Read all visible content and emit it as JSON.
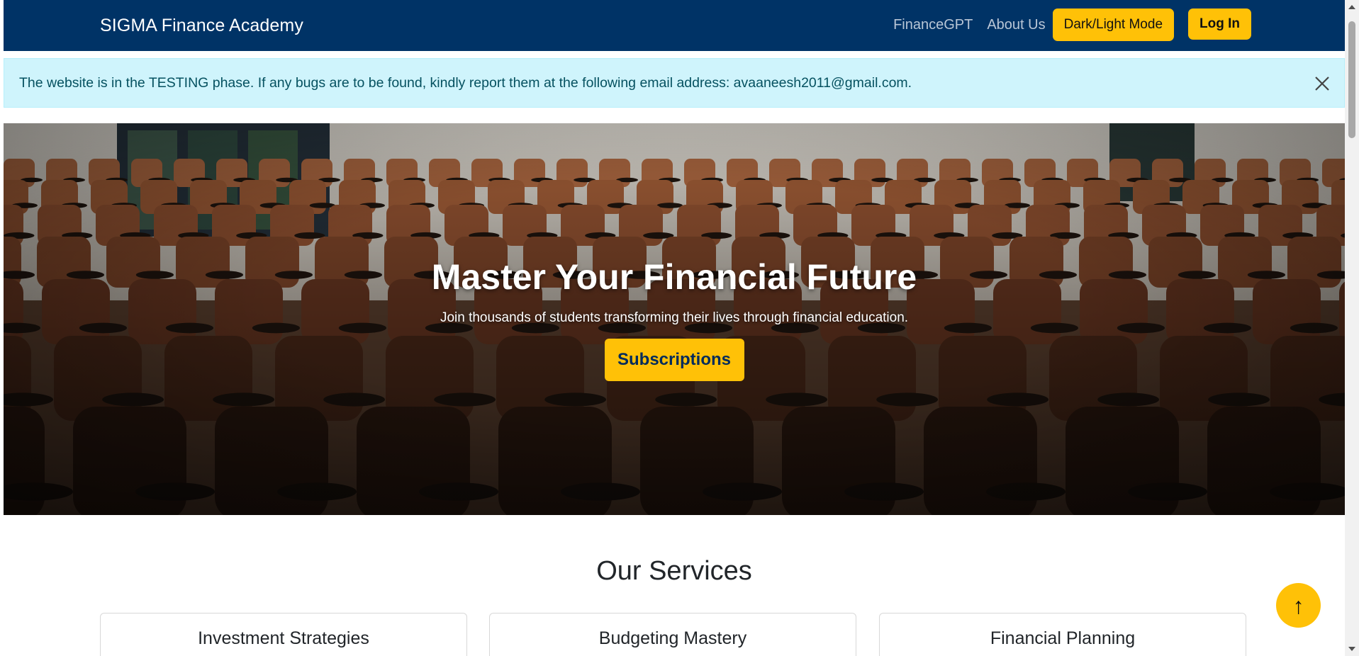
{
  "navbar": {
    "brand": "SIGMA Finance Academy",
    "links": [
      "FinanceGPT",
      "About Us"
    ],
    "theme_toggle": "Dark/Light Mode",
    "login": "Log In",
    "bg_color": "#003366",
    "accent_color": "#ffc107"
  },
  "alert": {
    "message": "The website is in the TESTING phase. If any bugs are to be found, kindly report them at the following email address: avaaneesh2011@gmail.com.",
    "close_icon": "close-icon"
  },
  "hero": {
    "title": "Master Your Financial Future",
    "subtitle": "Join thousands of students transforming their lives through financial education.",
    "cta": "Subscriptions",
    "background": "lecture-hall-chairs-photo"
  },
  "services": {
    "title": "Our Services",
    "cards": [
      {
        "title": "Investment Strategies"
      },
      {
        "title": "Budgeting Mastery"
      },
      {
        "title": "Financial Planning"
      }
    ]
  },
  "scroll_top": {
    "icon": "arrow-up-icon",
    "glyph": "↑"
  }
}
